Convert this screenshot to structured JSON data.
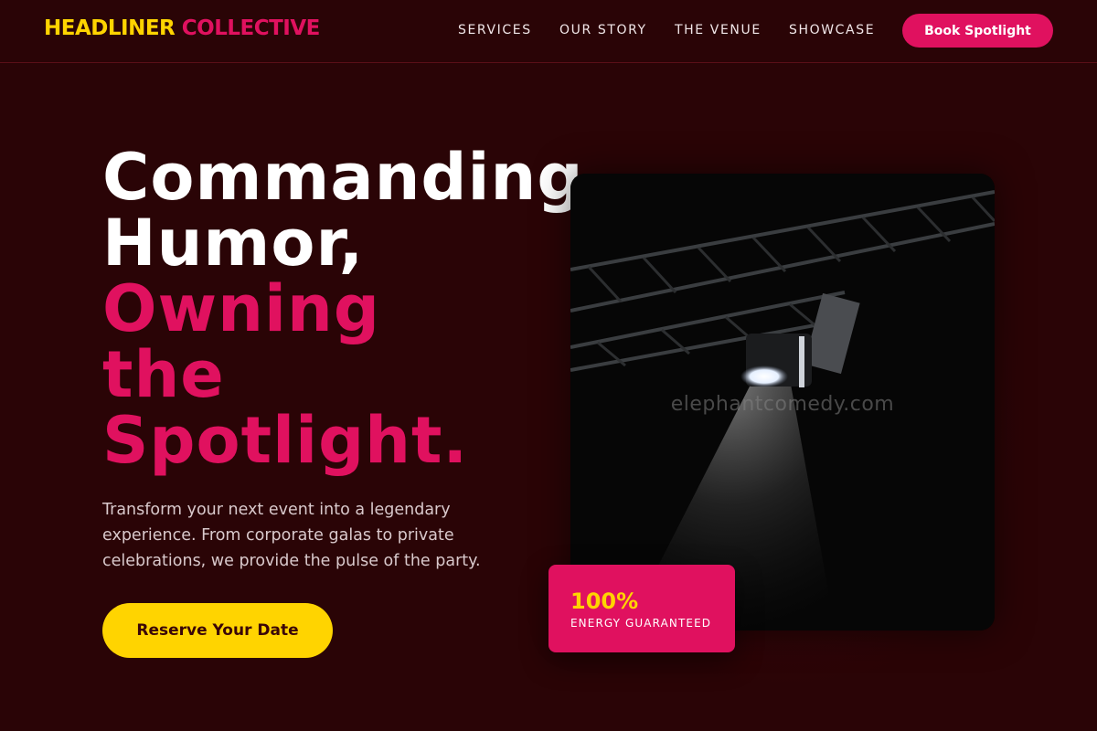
{
  "header": {
    "logo_part1": "HEADLINER",
    "logo_part2": "COLLECTIVE",
    "nav": [
      "SERVICES",
      "OUR STORY",
      "THE VENUE",
      "SHOWCASE"
    ],
    "book_label": "Book Spotlight"
  },
  "hero": {
    "headline_white": [
      "Commanding",
      "Humor,"
    ],
    "headline_pink": [
      "Owning",
      "the",
      "Spotlight."
    ],
    "subtext": "Transform your next event into a legendary experience. From corporate galas to private celebrations, we provide the pulse of the party.",
    "cta_label": "Reserve Your Date"
  },
  "image": {
    "watermark": "elephantcomedy.com",
    "badge_value": "100%",
    "badge_label": "ENERGY GUARANTEED"
  },
  "colors": {
    "background": "#2a0406",
    "accent_pink": "#e0115f",
    "accent_yellow": "#ffd400"
  }
}
